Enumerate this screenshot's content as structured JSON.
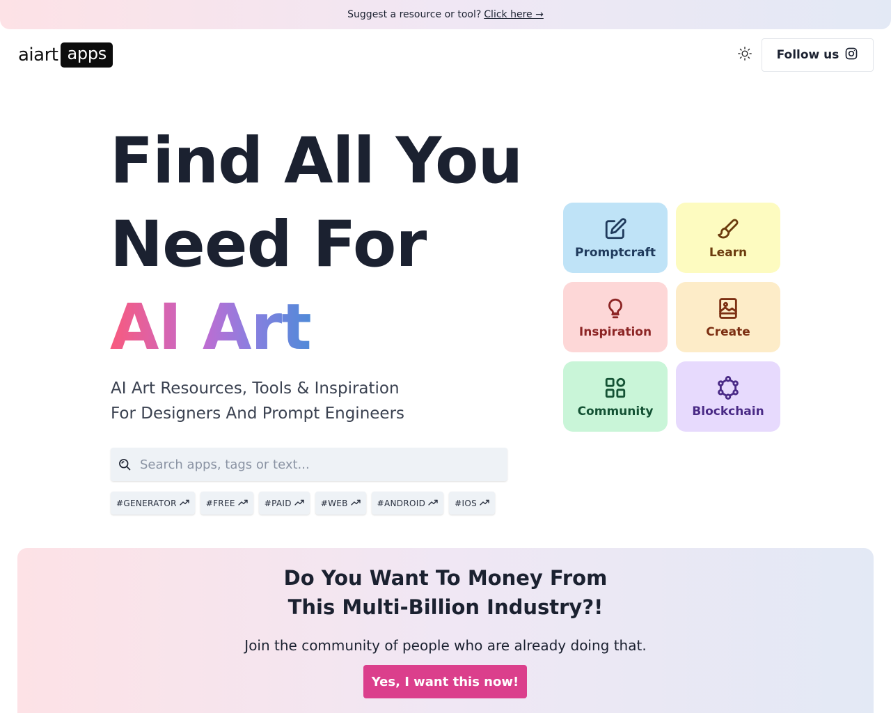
{
  "banner": {
    "text": "Suggest a resource or tool?",
    "link": "Click here →"
  },
  "header": {
    "logo_plain": "aiart",
    "logo_boxed": "apps",
    "follow_label": "Follow us"
  },
  "hero": {
    "line1": "Find All You",
    "line2": "Need For",
    "line3": "AI Art",
    "subtitle_line1": "AI Art Resources, Tools & Inspiration",
    "subtitle_line2": "For Designers And Prompt Engineers",
    "search_placeholder": "Search apps, tags or text...",
    "tags": [
      "#GENERATOR",
      "#FREE",
      "#PAID",
      "#WEB",
      "#ANDROID",
      "#IOS"
    ]
  },
  "categories": [
    {
      "label": "Promptcraft",
      "icon": "edit-icon",
      "bg": "#bfe3f7",
      "fg": "#1f3a5c"
    },
    {
      "label": "Learn",
      "icon": "brush-icon",
      "bg": "#fdfbc0",
      "fg": "#6b3b0e"
    },
    {
      "label": "Inspiration",
      "icon": "lightbulb-icon",
      "bg": "#fdd7d7",
      "fg": "#8c2525"
    },
    {
      "label": "Create",
      "icon": "image-icon",
      "bg": "#fdecc8",
      "fg": "#7c2f12"
    },
    {
      "label": "Community",
      "icon": "apps-grid-icon",
      "bg": "#c9f5d8",
      "fg": "#145234"
    },
    {
      "label": "Blockchain",
      "icon": "network-icon",
      "bg": "#e7dafd",
      "fg": "#4a2a86"
    }
  ],
  "cta": {
    "heading_line1": "Do You Want To Money From",
    "heading_line2": "This Multi-Billion Industry?!",
    "subtext": "Join the community of people who are already doing that.",
    "button": "Yes, I want this now!"
  },
  "colors": {
    "cta_button": "#db3f8c",
    "text": "#1b2130"
  }
}
